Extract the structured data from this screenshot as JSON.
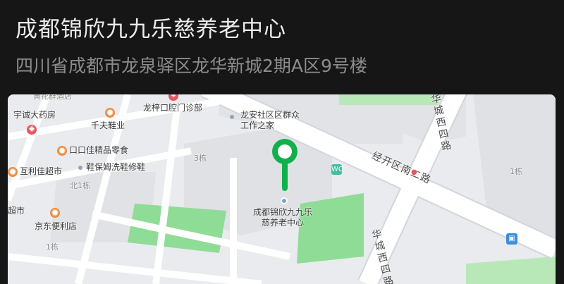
{
  "header": {
    "title": "成都锦欣九九乐慈养老中心",
    "address": "四川省成都市龙泉驿区龙华新城2期A区9号楼"
  },
  "map": {
    "destination_label": "成都锦欣九九乐慈养老中心",
    "pin_color": "#12b04c",
    "labels": {
      "yucheng_pharmacy": "宇诚大药房",
      "qianfu_shoes": "千夫鞋业",
      "longzi_dental": "龙梓口腔门诊部",
      "longan_community": "龙安社区区群众工作之家",
      "kk_store": "口口佳精品零食",
      "shoe_care": "鞋保姆洗鞋修鞋",
      "huli_market": "互利佳超市",
      "jd_store": "京东便利店",
      "supermarket_partial": "超市",
      "building_1": "1栋",
      "building_3": "3栋",
      "building_north1": "北1栋",
      "building_1_right": "1栋",
      "road_jingkai": "经开区南二路",
      "road_chengxi_top": "华城西四路",
      "road_chengxi_bottom": "华城西四路",
      "top_partial": "黄花群酒店"
    },
    "icons": {
      "restroom": "restroom-icon",
      "bus_stop": "bus-stop-icon",
      "traffic_light": "traffic-light-icon"
    }
  }
}
